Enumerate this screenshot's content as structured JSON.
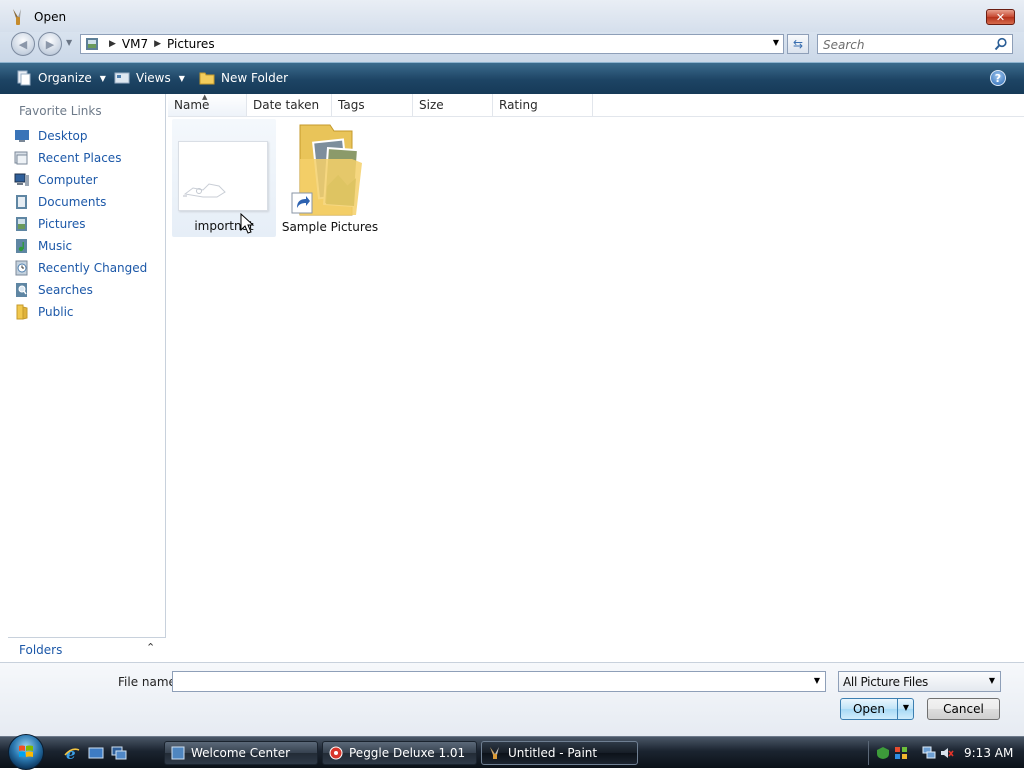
{
  "window": {
    "title": "Open",
    "close_symbol": "✕"
  },
  "address": {
    "crumbs": [
      "VM7",
      "Pictures"
    ],
    "search_placeholder": "Search"
  },
  "toolbar": {
    "organize": "Organize",
    "views": "Views",
    "new_folder": "New Folder",
    "help": "?"
  },
  "nav": {
    "favorites_header": "Favorite Links",
    "items": [
      {
        "label": "Desktop",
        "icon": "desktop-icon"
      },
      {
        "label": "Recent Places",
        "icon": "recent-places-icon"
      },
      {
        "label": "Computer",
        "icon": "computer-icon"
      },
      {
        "label": "Documents",
        "icon": "documents-icon"
      },
      {
        "label": "Pictures",
        "icon": "pictures-icon"
      },
      {
        "label": "Music",
        "icon": "music-icon"
      },
      {
        "label": "Recently Changed",
        "icon": "recently-changed-icon"
      },
      {
        "label": "Searches",
        "icon": "searches-icon"
      },
      {
        "label": "Public",
        "icon": "public-folder-icon"
      }
    ],
    "folders_label": "Folders"
  },
  "columns": [
    "Name",
    "Date taken",
    "Tags",
    "Size",
    "Rating"
  ],
  "files": [
    {
      "name": "importnat",
      "type": "image",
      "selected": true
    },
    {
      "name": "Sample Pictures",
      "type": "folder-shortcut",
      "selected": false
    }
  ],
  "bottom": {
    "filename_label": "File name:",
    "filename_value": "",
    "filetype_value": "All Picture Files",
    "open_label": "Open",
    "cancel_label": "Cancel"
  },
  "taskbar": {
    "tasks": [
      {
        "label": "Welcome Center",
        "active": false
      },
      {
        "label": "Peggle Deluxe 1.01",
        "active": false
      },
      {
        "label": "Untitled - Paint",
        "active": true
      }
    ],
    "clock": "9:13 AM"
  },
  "colors": {
    "toolbar_bg": "#1d4464",
    "link_blue": "#1c58a8",
    "taskbar_bg": "#1b2430",
    "close_red": "#c64730"
  }
}
